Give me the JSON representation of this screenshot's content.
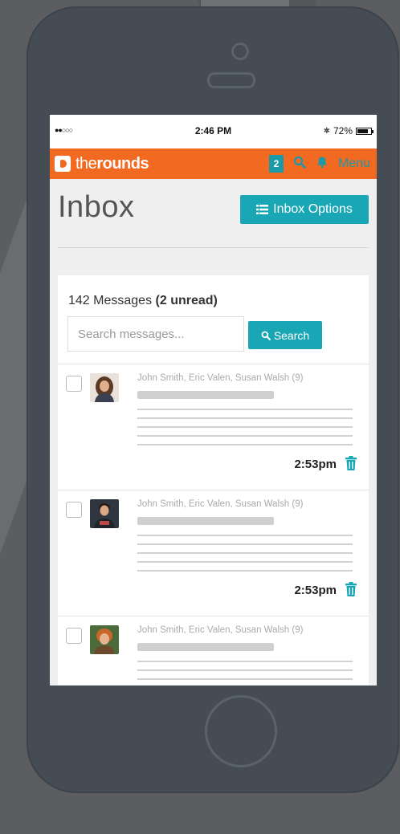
{
  "status_bar": {
    "signal": "●●○○○",
    "time": "2:46 PM",
    "bluetooth": "✱",
    "battery": "72%"
  },
  "nav": {
    "logo_light": "the",
    "logo_bold": "rounds",
    "badge": "2",
    "menu": "Menu",
    "accent": "#f26a21",
    "teal": "#1aa7b5"
  },
  "page": {
    "title": "Inbox",
    "options_label": "Inbox Options"
  },
  "inbox": {
    "count_text": "142 Messages",
    "unread_text": "(2 unread)",
    "search_placeholder": "Search messages...",
    "search_button": "Search"
  },
  "messages": [
    {
      "from": "John Smith, Eric Valen, Susan Walsh (9)",
      "time": "2:53pm",
      "avatar": "avatar-woman-curly-hair"
    },
    {
      "from": "John Smith, Eric Valen, Susan Walsh (9)",
      "time": "2:53pm",
      "avatar": "avatar-man-dark-shirt"
    },
    {
      "from": "John Smith, Eric Valen, Susan Walsh (9)",
      "time": "",
      "avatar": "avatar-man-orange-hair"
    }
  ],
  "icons": {
    "search": "search-icon",
    "bell": "bell-icon",
    "list": "list-icon",
    "trash": "trash-icon"
  }
}
